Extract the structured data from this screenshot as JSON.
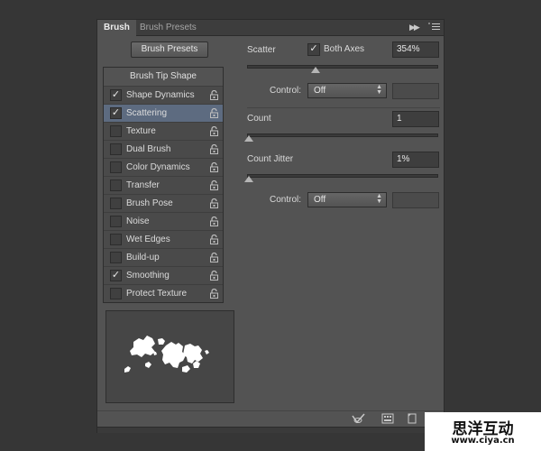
{
  "tabs": [
    {
      "label": "Brush",
      "active": true
    },
    {
      "label": "Brush Presets",
      "active": false
    }
  ],
  "toolbar": {
    "collapse_icon": "double-chevron-right-icon",
    "menu_icon": "panel-menu-icon"
  },
  "brush_presets_button": "Brush Presets",
  "brush_tip_shape": "Brush Tip Shape",
  "settings": [
    {
      "label": "Shape Dynamics",
      "checked": true,
      "selected": false
    },
    {
      "label": "Scattering",
      "checked": true,
      "selected": true
    },
    {
      "label": "Texture",
      "checked": false,
      "selected": false
    },
    {
      "label": "Dual Brush",
      "checked": false,
      "selected": false
    },
    {
      "label": "Color Dynamics",
      "checked": false,
      "selected": false
    },
    {
      "label": "Transfer",
      "checked": false,
      "selected": false
    },
    {
      "label": "Brush Pose",
      "checked": false,
      "selected": false
    },
    {
      "label": "Noise",
      "checked": false,
      "selected": false
    },
    {
      "label": "Wet Edges",
      "checked": false,
      "selected": false
    },
    {
      "label": "Build-up",
      "checked": false,
      "selected": false
    },
    {
      "label": "Smoothing",
      "checked": true,
      "selected": false
    },
    {
      "label": "Protect Texture",
      "checked": false,
      "selected": false
    }
  ],
  "scattering": {
    "scatter_label": "Scatter",
    "both_axes_label": "Both Axes",
    "both_axes_checked": true,
    "scatter_value": "354%",
    "scatter_control_label": "Control:",
    "scatter_control_value": "Off",
    "count_label": "Count",
    "count_value": "1",
    "count_jitter_label": "Count Jitter",
    "count_jitter_value": "1%",
    "count_control_label": "Control:",
    "count_control_value": "Off"
  },
  "footer_icons": [
    "toggle-live-tip-icon",
    "brush-grid-icon",
    "new-preset-icon"
  ],
  "watermark": {
    "title": "思洋互动",
    "url": "www.ciya.cn"
  }
}
